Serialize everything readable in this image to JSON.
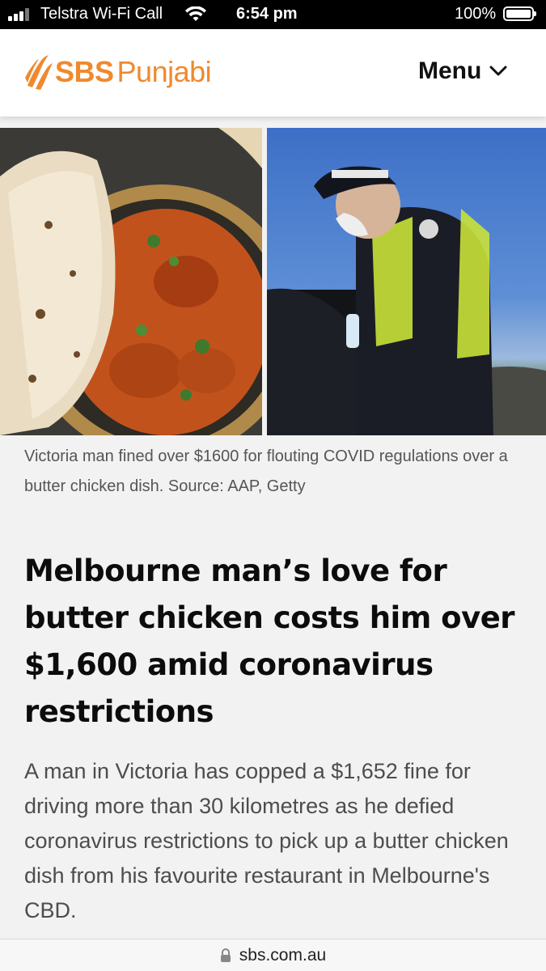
{
  "status_bar": {
    "carrier": "Telstra Wi-Fi Call",
    "time": "6:54 pm",
    "battery": "100%"
  },
  "header": {
    "logo_brand": "SBS",
    "logo_section": "Punjabi",
    "menu_label": "Menu",
    "brand_color": "#f0892d"
  },
  "article": {
    "image_caption": "Victoria man fined over $1600 for flouting COVID regulations over a butter chicken dish. Source: AAP, Getty",
    "headline": "Melbourne man’s love for butter chicken costs him over $1,600 amid coronavirus restrictions",
    "lede": "A man in Victoria has copped a $1,652 fine for driving more than 30 kilometres as he defied coronavirus restrictions to pick up a butter chicken dish from his favourite restaurant in Melbourne's CBD."
  },
  "browser": {
    "url": "sbs.com.au"
  },
  "icons": {
    "signal": "cellular-signal-icon",
    "wifi": "wifi-icon",
    "battery": "battery-icon",
    "menu_chevron": "chevron-down-icon",
    "lock": "lock-icon"
  }
}
